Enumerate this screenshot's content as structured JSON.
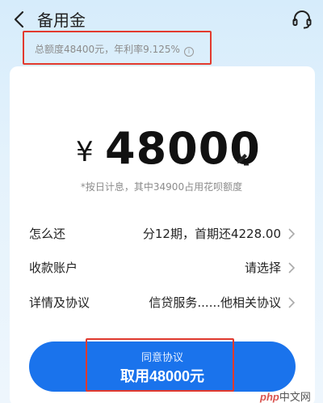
{
  "header": {
    "title": "备用金",
    "back_icon": "chevron-left-icon",
    "support_icon": "headset-icon"
  },
  "quota": {
    "text": "总额度48400元，年利率9.125%",
    "info_icon": "i"
  },
  "loan": {
    "currency": "¥",
    "amount": "48000",
    "edit_icon": "pencil-icon",
    "note": "*按日计息，其中34900占用花呗额度"
  },
  "rows": [
    {
      "label": "怎么还",
      "value": "分12期，首期还4228.00"
    },
    {
      "label": "收款账户",
      "value": "请选择"
    },
    {
      "label": "详情及协议",
      "value": "信贷服务......他相关协议"
    }
  ],
  "cta": {
    "sub_label": "同意协议",
    "main_label": "取用48000元"
  },
  "watermark": {
    "brand": "php",
    "site": "中文网"
  },
  "colors": {
    "accent": "#1a73ec",
    "highlight": "#e23a2e",
    "muted": "#8c8c8c"
  }
}
